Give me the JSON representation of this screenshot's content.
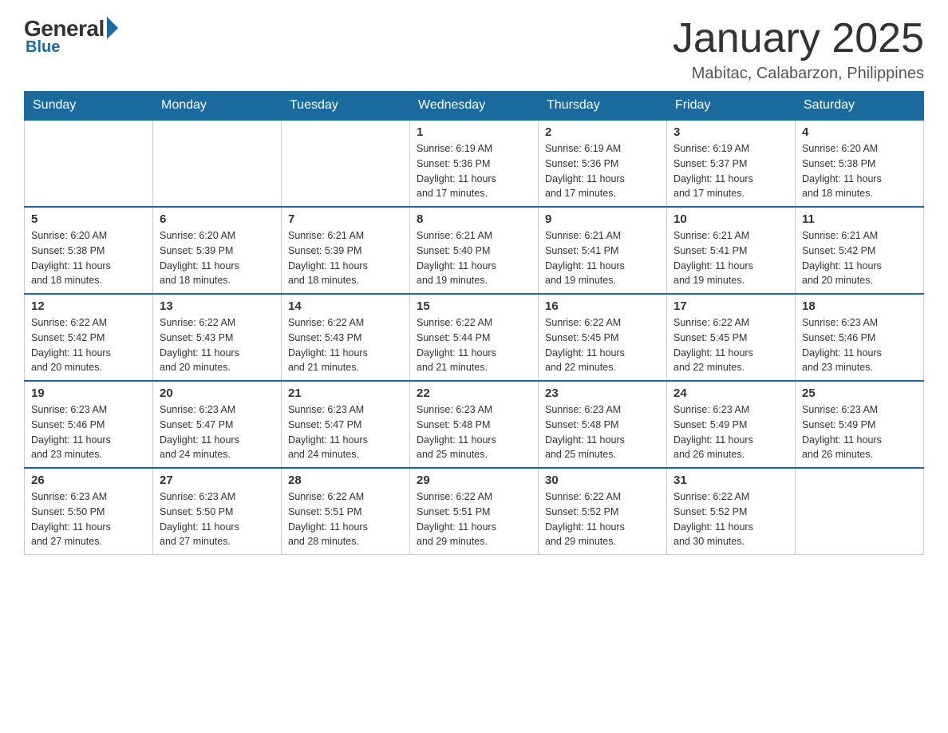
{
  "logo": {
    "general": "General",
    "blue": "Blue"
  },
  "title": "January 2025",
  "location": "Mabitac, Calabarzon, Philippines",
  "days_header": [
    "Sunday",
    "Monday",
    "Tuesday",
    "Wednesday",
    "Thursday",
    "Friday",
    "Saturday"
  ],
  "weeks": [
    [
      {
        "day": "",
        "info": ""
      },
      {
        "day": "",
        "info": ""
      },
      {
        "day": "",
        "info": ""
      },
      {
        "day": "1",
        "info": "Sunrise: 6:19 AM\nSunset: 5:36 PM\nDaylight: 11 hours\nand 17 minutes."
      },
      {
        "day": "2",
        "info": "Sunrise: 6:19 AM\nSunset: 5:36 PM\nDaylight: 11 hours\nand 17 minutes."
      },
      {
        "day": "3",
        "info": "Sunrise: 6:19 AM\nSunset: 5:37 PM\nDaylight: 11 hours\nand 17 minutes."
      },
      {
        "day": "4",
        "info": "Sunrise: 6:20 AM\nSunset: 5:38 PM\nDaylight: 11 hours\nand 18 minutes."
      }
    ],
    [
      {
        "day": "5",
        "info": "Sunrise: 6:20 AM\nSunset: 5:38 PM\nDaylight: 11 hours\nand 18 minutes."
      },
      {
        "day": "6",
        "info": "Sunrise: 6:20 AM\nSunset: 5:39 PM\nDaylight: 11 hours\nand 18 minutes."
      },
      {
        "day": "7",
        "info": "Sunrise: 6:21 AM\nSunset: 5:39 PM\nDaylight: 11 hours\nand 18 minutes."
      },
      {
        "day": "8",
        "info": "Sunrise: 6:21 AM\nSunset: 5:40 PM\nDaylight: 11 hours\nand 19 minutes."
      },
      {
        "day": "9",
        "info": "Sunrise: 6:21 AM\nSunset: 5:41 PM\nDaylight: 11 hours\nand 19 minutes."
      },
      {
        "day": "10",
        "info": "Sunrise: 6:21 AM\nSunset: 5:41 PM\nDaylight: 11 hours\nand 19 minutes."
      },
      {
        "day": "11",
        "info": "Sunrise: 6:21 AM\nSunset: 5:42 PM\nDaylight: 11 hours\nand 20 minutes."
      }
    ],
    [
      {
        "day": "12",
        "info": "Sunrise: 6:22 AM\nSunset: 5:42 PM\nDaylight: 11 hours\nand 20 minutes."
      },
      {
        "day": "13",
        "info": "Sunrise: 6:22 AM\nSunset: 5:43 PM\nDaylight: 11 hours\nand 20 minutes."
      },
      {
        "day": "14",
        "info": "Sunrise: 6:22 AM\nSunset: 5:43 PM\nDaylight: 11 hours\nand 21 minutes."
      },
      {
        "day": "15",
        "info": "Sunrise: 6:22 AM\nSunset: 5:44 PM\nDaylight: 11 hours\nand 21 minutes."
      },
      {
        "day": "16",
        "info": "Sunrise: 6:22 AM\nSunset: 5:45 PM\nDaylight: 11 hours\nand 22 minutes."
      },
      {
        "day": "17",
        "info": "Sunrise: 6:22 AM\nSunset: 5:45 PM\nDaylight: 11 hours\nand 22 minutes."
      },
      {
        "day": "18",
        "info": "Sunrise: 6:23 AM\nSunset: 5:46 PM\nDaylight: 11 hours\nand 23 minutes."
      }
    ],
    [
      {
        "day": "19",
        "info": "Sunrise: 6:23 AM\nSunset: 5:46 PM\nDaylight: 11 hours\nand 23 minutes."
      },
      {
        "day": "20",
        "info": "Sunrise: 6:23 AM\nSunset: 5:47 PM\nDaylight: 11 hours\nand 24 minutes."
      },
      {
        "day": "21",
        "info": "Sunrise: 6:23 AM\nSunset: 5:47 PM\nDaylight: 11 hours\nand 24 minutes."
      },
      {
        "day": "22",
        "info": "Sunrise: 6:23 AM\nSunset: 5:48 PM\nDaylight: 11 hours\nand 25 minutes."
      },
      {
        "day": "23",
        "info": "Sunrise: 6:23 AM\nSunset: 5:48 PM\nDaylight: 11 hours\nand 25 minutes."
      },
      {
        "day": "24",
        "info": "Sunrise: 6:23 AM\nSunset: 5:49 PM\nDaylight: 11 hours\nand 26 minutes."
      },
      {
        "day": "25",
        "info": "Sunrise: 6:23 AM\nSunset: 5:49 PM\nDaylight: 11 hours\nand 26 minutes."
      }
    ],
    [
      {
        "day": "26",
        "info": "Sunrise: 6:23 AM\nSunset: 5:50 PM\nDaylight: 11 hours\nand 27 minutes."
      },
      {
        "day": "27",
        "info": "Sunrise: 6:23 AM\nSunset: 5:50 PM\nDaylight: 11 hours\nand 27 minutes."
      },
      {
        "day": "28",
        "info": "Sunrise: 6:22 AM\nSunset: 5:51 PM\nDaylight: 11 hours\nand 28 minutes."
      },
      {
        "day": "29",
        "info": "Sunrise: 6:22 AM\nSunset: 5:51 PM\nDaylight: 11 hours\nand 29 minutes."
      },
      {
        "day": "30",
        "info": "Sunrise: 6:22 AM\nSunset: 5:52 PM\nDaylight: 11 hours\nand 29 minutes."
      },
      {
        "day": "31",
        "info": "Sunrise: 6:22 AM\nSunset: 5:52 PM\nDaylight: 11 hours\nand 30 minutes."
      },
      {
        "day": "",
        "info": ""
      }
    ]
  ]
}
